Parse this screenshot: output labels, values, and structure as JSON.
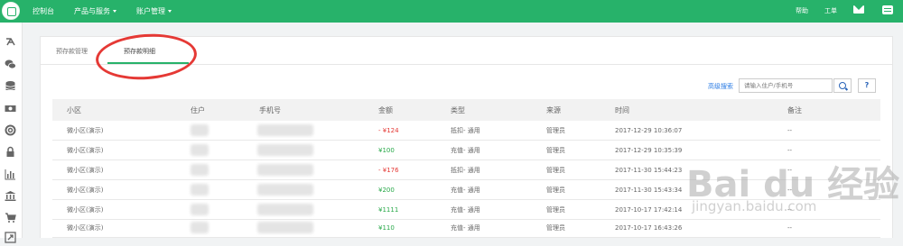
{
  "topbar": {
    "nav": [
      {
        "label": "控制台",
        "has_caret": false
      },
      {
        "label": "产品与服务",
        "has_caret": true
      },
      {
        "label": "账户管理",
        "has_caret": true
      }
    ],
    "help": "帮助",
    "ticket": "工单"
  },
  "sidebar": {
    "icons": [
      "coupon-icon",
      "wechat-icon",
      "database-icon",
      "money-icon",
      "lifebuoy-icon",
      "lock-icon",
      "bar-chart-icon",
      "bank-icon",
      "cart-icon",
      "share-icon"
    ]
  },
  "tabs": [
    {
      "label": "预存款管理",
      "active": false
    },
    {
      "label": "预存款明细",
      "active": true
    }
  ],
  "search": {
    "advanced": "高级搜索",
    "placeholder": "请输入住户/手机号",
    "help": "?"
  },
  "table": {
    "columns": [
      "小区",
      "住户",
      "手机号",
      "金额",
      "类型",
      "来源",
      "时间",
      "备注"
    ],
    "rows": [
      {
        "community": "微小区(演示)",
        "amount": "- ¥124",
        "sign": "neg",
        "type": "抵扣- 通用",
        "source": "管理员",
        "time": "2017-12-29 10:36:07",
        "note": "--"
      },
      {
        "community": "微小区(演示)",
        "amount": "¥100",
        "sign": "pos",
        "type": "充值- 通用",
        "source": "管理员",
        "time": "2017-12-29 10:35:39",
        "note": "--"
      },
      {
        "community": "微小区(演示)",
        "amount": "- ¥176",
        "sign": "neg",
        "type": "抵扣- 通用",
        "source": "管理员",
        "time": "2017-11-30 15:44:23",
        "note": "--"
      },
      {
        "community": "微小区(演示)",
        "amount": "¥200",
        "sign": "pos",
        "type": "充值- 通用",
        "source": "管理员",
        "time": "2017-11-30 15:43:34",
        "note": "--"
      },
      {
        "community": "微小区(演示)",
        "amount": "¥1111",
        "sign": "pos",
        "type": "充值- 通用",
        "source": "管理员",
        "time": "2017-10-17 17:42:14",
        "note": "--"
      },
      {
        "community": "微小区(演示)",
        "amount": "¥110",
        "sign": "pos",
        "type": "充值- 通用",
        "source": "管理员",
        "time": "2017-10-17 16:43:26",
        "note": "--"
      }
    ]
  },
  "watermark": {
    "logo": "Bai du 经验",
    "url": "jingyan.baidu.com"
  },
  "colors": {
    "brand": "#27b26a",
    "negative": "#e53935",
    "positive": "#27a848",
    "link": "#2a7be4",
    "annotation": "#e53935"
  }
}
